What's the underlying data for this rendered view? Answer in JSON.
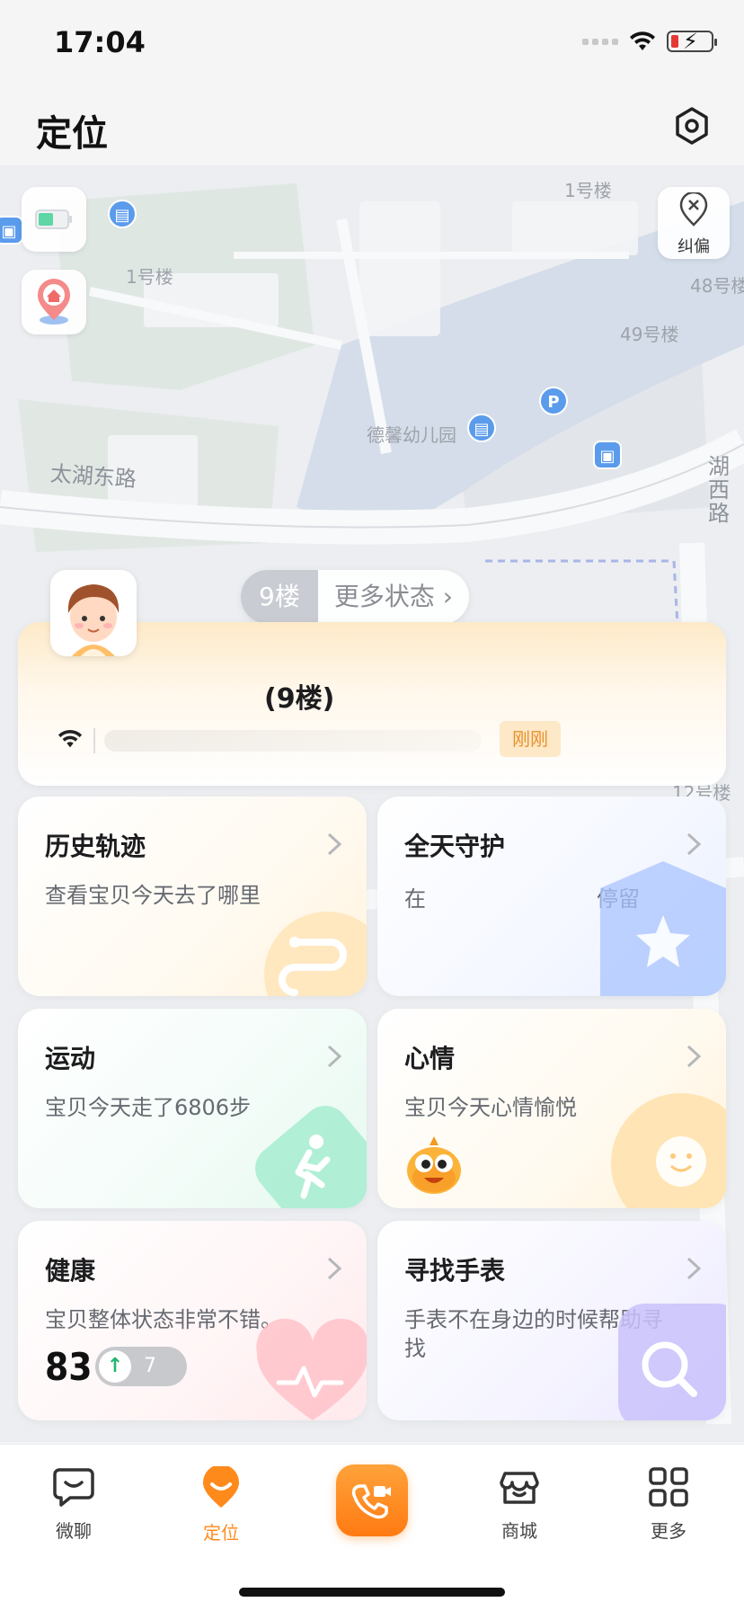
{
  "status_bar": {
    "time": "17:04"
  },
  "header": {
    "title": "定位"
  },
  "map": {
    "labels": [
      "1号楼",
      "1号楼",
      "48号楼",
      "49号楼",
      "德馨幼儿园",
      "太湖东路",
      "湖西路",
      "12号楼"
    ],
    "correct_label": "纠偏"
  },
  "floor_pill": {
    "floor": "9楼",
    "more": "更多状态"
  },
  "location_card": {
    "title": "(9楼)",
    "badge": "刚刚"
  },
  "cards": {
    "history": {
      "title": "历史轨迹",
      "desc": "查看宝贝今天去了哪里"
    },
    "guard": {
      "title": "全天守护",
      "desc_prefix": "在",
      "desc_suffix": "停留"
    },
    "sport": {
      "title": "运动",
      "desc": "宝贝今天走了6806步"
    },
    "mood": {
      "title": "心情",
      "desc": "宝贝今天心情愉悦"
    },
    "health": {
      "title": "健康",
      "desc": "宝贝整体状态非常不错。",
      "score": "83",
      "trend": "7"
    },
    "find": {
      "title": "寻找手表",
      "desc": "手表不在身边的时候帮助寻找"
    }
  },
  "tabs": [
    {
      "label": "微聊",
      "icon": "chat-icon"
    },
    {
      "label": "定位",
      "icon": "location-icon"
    },
    {
      "label": "",
      "icon": "video-call-icon"
    },
    {
      "label": "商城",
      "icon": "shop-icon"
    },
    {
      "label": "更多",
      "icon": "grid-icon"
    }
  ],
  "colors": {
    "accent": "#ff8a1c",
    "badge_text": "#e8912a",
    "trend_up": "#22b573"
  }
}
